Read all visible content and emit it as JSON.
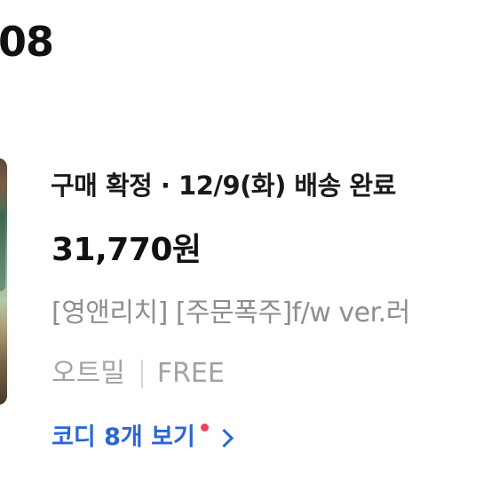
{
  "header": {
    "date_partial": "08"
  },
  "order": {
    "status_text": "구매 확정 · 12/9(화) 배송 완료",
    "price": "31,770원",
    "product_name": "[영앤리치] [주문폭주]f/w ver.러",
    "option_color": "오트밀",
    "option_size": "FREE",
    "coordi_link_label": "코디 8개 보기"
  },
  "colors": {
    "link_blue": "#2a66d9",
    "notification_dot": "#f0445c"
  },
  "icons": {
    "link_arrow": "chevron-right-icon",
    "new_badge": "notification-dot-icon"
  }
}
